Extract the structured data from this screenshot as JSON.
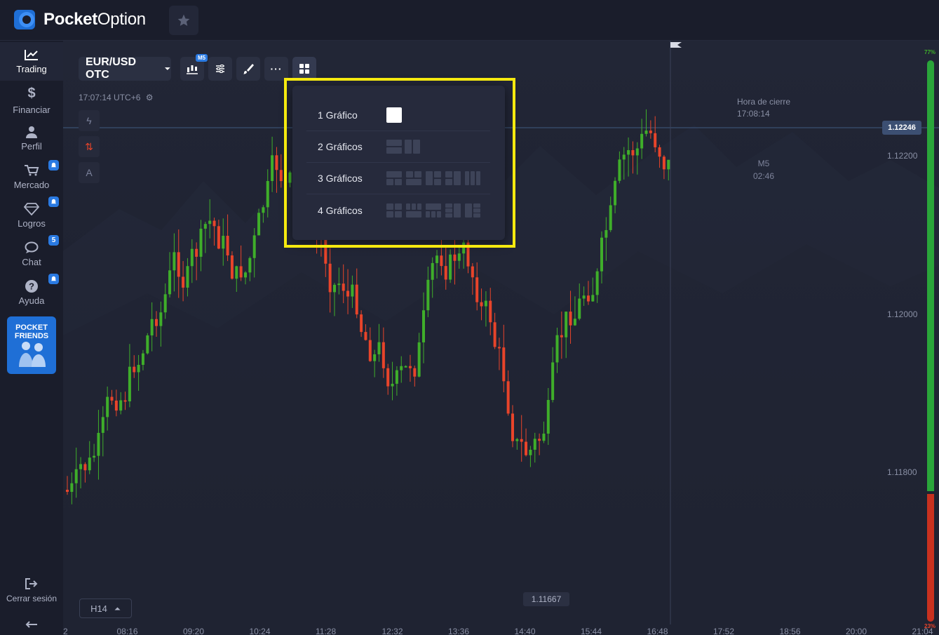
{
  "app": {
    "brand_bold": "Pocket",
    "brand_light": "Option"
  },
  "topbar": {
    "favorite_icon": "star-icon"
  },
  "sidebar": {
    "items": [
      {
        "label": "Trading",
        "icon": "chart-line-icon",
        "active": true
      },
      {
        "label": "Financiar",
        "icon": "dollar-icon"
      },
      {
        "label": "Perfil",
        "icon": "user-icon"
      },
      {
        "label": "Mercado",
        "icon": "cart-icon",
        "badge": "bell"
      },
      {
        "label": "Logros",
        "icon": "diamond-icon",
        "badge": "bell"
      },
      {
        "label": "Chat",
        "icon": "chat-icon",
        "badge": "5"
      },
      {
        "label": "Ayuda",
        "icon": "help-icon",
        "badge": "bell"
      }
    ],
    "friends_banner": {
      "line1": "POCKET",
      "line2": "FRIENDS"
    },
    "logout_label": "Cerrar sesión"
  },
  "toolbar": {
    "pair": "EUR/USD OTC",
    "timeframe_badge": "M5",
    "server_time": "17:07:14 UTC+6"
  },
  "layout_menu": {
    "rows": [
      {
        "label": "1 Gráfico",
        "variants": 1
      },
      {
        "label": "2 Gráficos",
        "variants": 2
      },
      {
        "label": "3 Gráficos",
        "variants": 5
      },
      {
        "label": "4 Gráficos",
        "variants": 5
      }
    ]
  },
  "chart": {
    "closing_title": "Hora de cierre",
    "closing_time": "17:08:14",
    "candle_timeframe": "M5",
    "candle_countdown": "02:46",
    "current_price": "1.12246",
    "price_labels": [
      "1.12200",
      "1.12000",
      "1.11800"
    ],
    "low_price": "1.11667",
    "time_labels": [
      "2",
      "08:16",
      "09:20",
      "10:24",
      "11:28",
      "12:32",
      "13:36",
      "14:40",
      "15:44",
      "16:48",
      "17:52",
      "18:56",
      "20:00",
      "21:04"
    ],
    "period_selector": "H14",
    "sentiment_up": "77%",
    "sentiment_down": "23%",
    "colors": {
      "bull": "#3fae2a",
      "bear": "#e8442a",
      "accent": "#2a7ae2",
      "highlight": "#f5e90f"
    }
  }
}
